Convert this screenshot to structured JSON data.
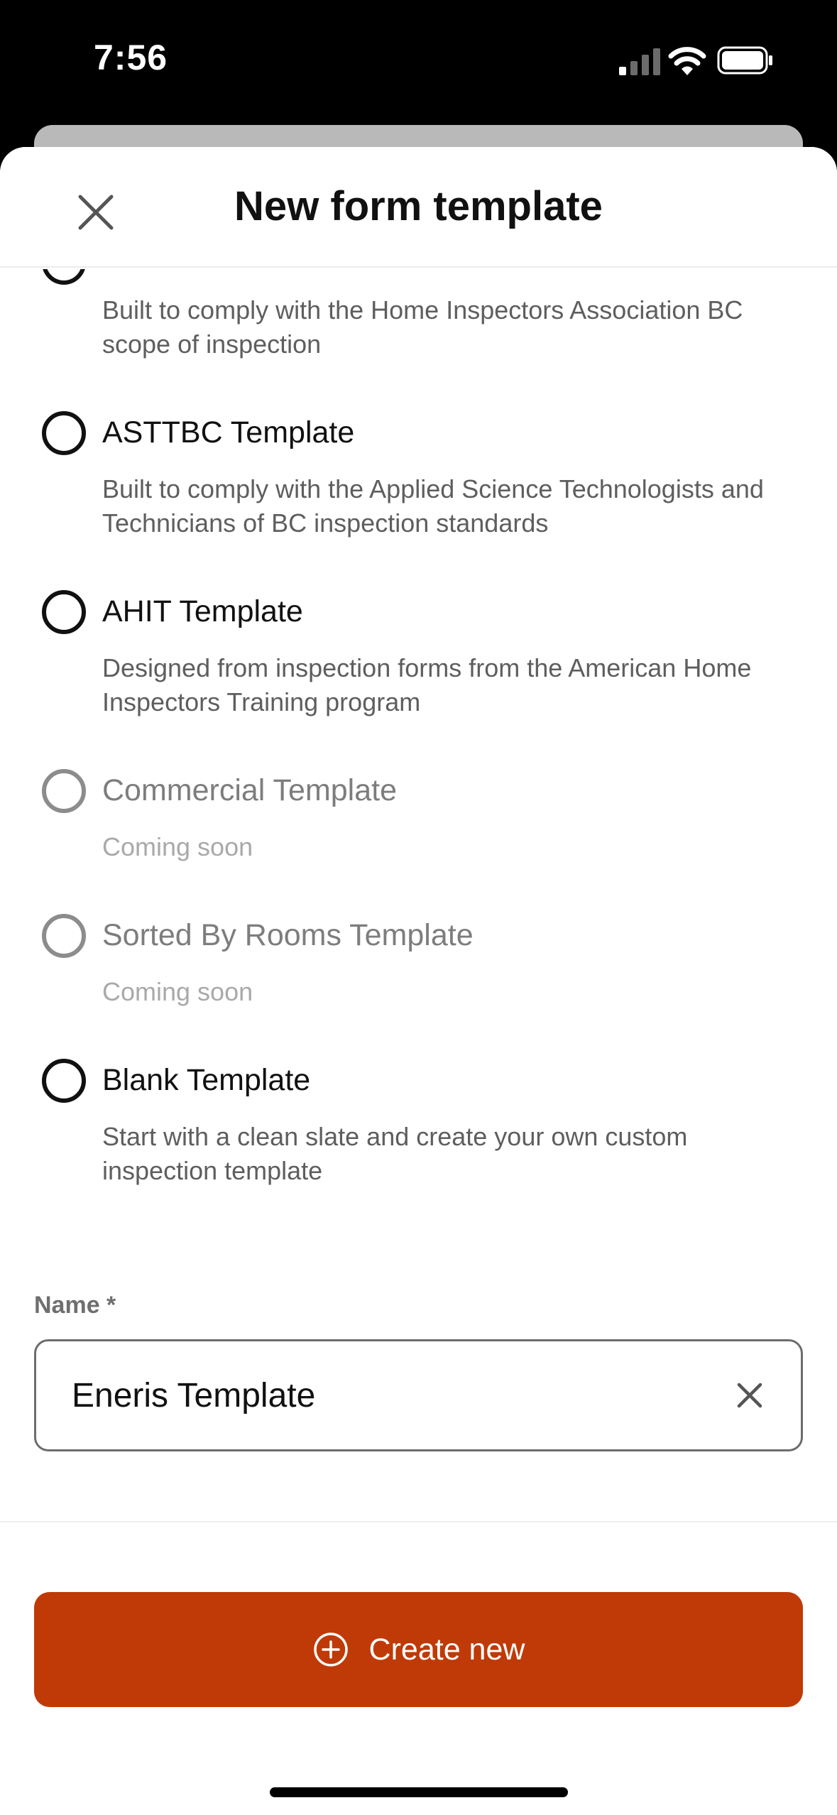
{
  "status_bar": {
    "time": "7:56",
    "icons": [
      "cellular-signal-icon",
      "wifi-icon",
      "battery-icon"
    ]
  },
  "header": {
    "title": "New form template",
    "close_icon": "close-icon"
  },
  "templates": [
    {
      "title": "",
      "description": "Built to comply with the Home Inspectors Association BC scope of inspection",
      "disabled": false
    },
    {
      "title": "ASTTBC Template",
      "description": "Built to comply with the Applied Science Technologists and Technicians of BC inspection standards",
      "disabled": false
    },
    {
      "title": "AHIT Template",
      "description": "Designed from inspection forms from the American Home Inspectors Training program",
      "disabled": false
    },
    {
      "title": "Commercial Template",
      "description": "Coming soon",
      "disabled": true
    },
    {
      "title": "Sorted By Rooms Template",
      "description": "Coming soon",
      "disabled": true
    },
    {
      "title": "Blank Template",
      "description": "Start with a clean slate and create your own custom inspection template",
      "disabled": false
    }
  ],
  "name_field": {
    "label": "Name *",
    "value": "Eneris Template"
  },
  "create_button": {
    "label": "Create new"
  },
  "colors": {
    "accent": "#bf3a06",
    "text": "#111111",
    "secondary_text": "#5e5e5e",
    "disabled_text": "#a9a9a9"
  }
}
